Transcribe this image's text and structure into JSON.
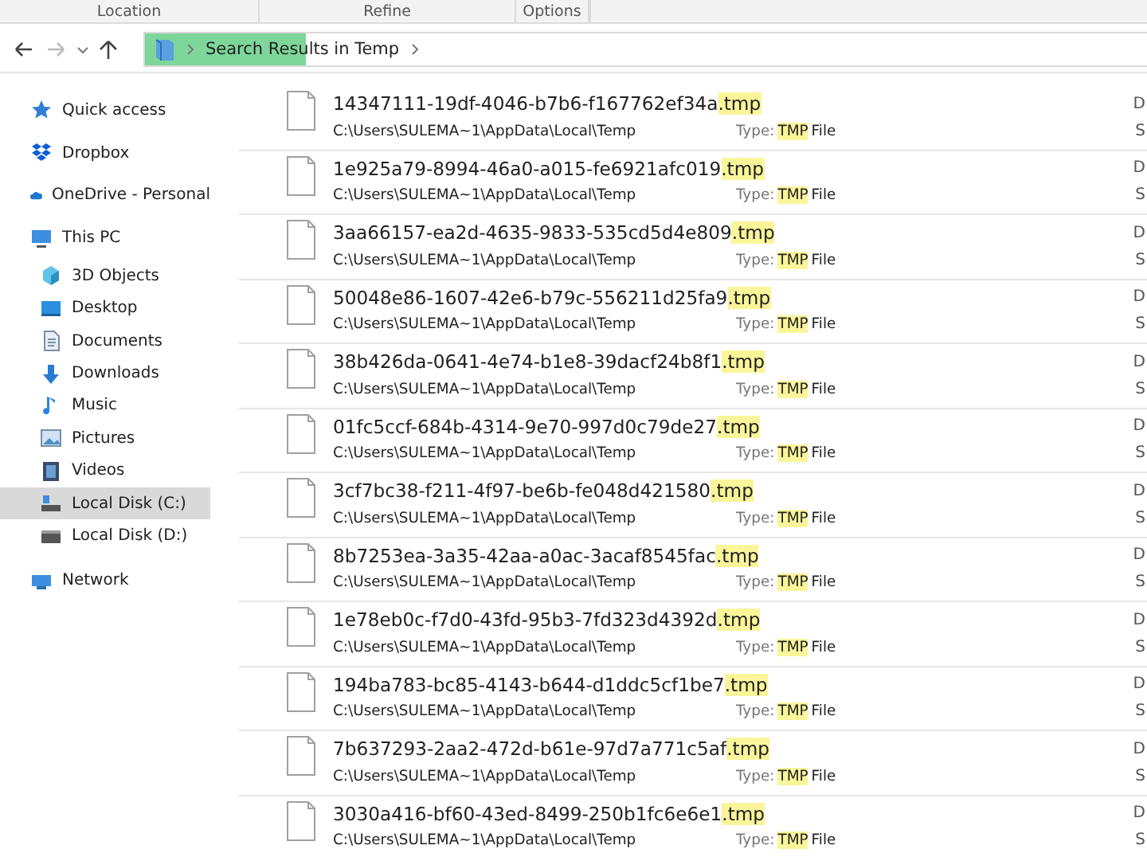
{
  "ribbon": {
    "groups": [
      "Location",
      "Refine",
      "Options"
    ]
  },
  "address_bar": {
    "crumbs": [
      "Search Results in Temp"
    ],
    "level": 0.16
  },
  "sidebar": {
    "items": [
      {
        "label": "Quick access",
        "selected": false
      },
      {
        "label": "Dropbox",
        "selected": false
      },
      {
        "label": "OneDrive - Personal",
        "selected": false
      },
      {
        "label": "This PC",
        "selected": false,
        "children": [
          {
            "label": "3D Objects",
            "selected": false
          },
          {
            "label": "Desktop",
            "selected": false
          },
          {
            "label": "Documents",
            "selected": false
          },
          {
            "label": "Downloads",
            "selected": false
          },
          {
            "label": "Music",
            "selected": false
          },
          {
            "label": "Pictures",
            "selected": false
          },
          {
            "label": "Videos",
            "selected": false
          },
          {
            "label": "Local Disk (C:)",
            "selected": true
          },
          {
            "label": "Local Disk (D:)",
            "selected": false
          }
        ]
      },
      {
        "label": "Network",
        "selected": false
      }
    ]
  },
  "results": [
    {
      "name": "14347111-19df-4046-b7b6-f167762ef34a",
      "extension": ".tmp",
      "path": "C:\\Users\\SULEMA~1\\AppData\\Local\\Temp",
      "type_label": "Type:",
      "type": "TMP",
      "type_suffix": "File",
      "column_3": "D",
      "column_4": "S"
    },
    {
      "name": "1e925a79-8994-46a0-a015-fe6921afc019",
      "extension": ".tmp",
      "path": "C:\\Users\\SULEMA~1\\AppData\\Local\\Temp",
      "type_label": "Type:",
      "type": "TMP",
      "type_suffix": "File",
      "column_3": "D",
      "column_4": "S"
    },
    {
      "name": "3aa66157-ea2d-4635-9833-535cd5d4e809",
      "extension": ".tmp",
      "path": "C:\\Users\\SULEMA~1\\AppData\\Local\\Temp",
      "type_label": "Type:",
      "type": "TMP",
      "type_suffix": "File",
      "column_3": "D",
      "column_4": "S"
    },
    {
      "name": "50048e86-1607-42e6-b79c-556211d25fa9",
      "extension": ".tmp",
      "path": "C:\\Users\\SULEMA~1\\AppData\\Local\\Temp",
      "type_label": "Type:",
      "type": "TMP",
      "type_suffix": "File",
      "column_3": "D",
      "column_4": "S"
    },
    {
      "name": "38b426da-0641-4e74-b1e8-39dacf24b8f1",
      "extension": ".tmp",
      "path": "C:\\Users\\SULEMA~1\\AppData\\Local\\Temp",
      "type_label": "Type:",
      "type": "TMP",
      "type_suffix": "File",
      "column_3": "D",
      "column_4": "S"
    },
    {
      "name": "01fc5ccf-684b-4314-9e70-997d0c79de27",
      "extension": ".tmp",
      "path": "C:\\Users\\SULEMA~1\\AppData\\Local\\Temp",
      "type_label": "Type:",
      "type": "TMP",
      "type_suffix": "File",
      "column_3": "D",
      "column_4": "S"
    },
    {
      "name": "3cf7bc38-f211-4f97-be6b-fe048d421580",
      "extension": ".tmp",
      "path": "C:\\Users\\SULEMA~1\\AppData\\Local\\Temp",
      "type_label": "Type:",
      "type": "TMP",
      "type_suffix": "File",
      "column_3": "D",
      "column_4": "S"
    },
    {
      "name": "8b7253ea-3a35-42aa-a0ac-3acaf8545fac",
      "extension": ".tmp",
      "path": "C:\\Users\\SULEMA~1\\AppData\\Local\\Temp",
      "type_label": "Type:",
      "type": "TMP",
      "type_suffix": "File",
      "column_3": "D",
      "column_4": "S"
    },
    {
      "name": "1e78eb0c-f7d0-43fd-95b3-7fd323d4392d",
      "extension": ".tmp",
      "path": "C:\\Users\\SULEMA~1\\AppData\\Local\\Temp",
      "type_label": "Type:",
      "type": "TMP",
      "type_suffix": "File",
      "column_3": "D",
      "column_4": "S"
    },
    {
      "name": "194ba783-bc85-4143-b644-d1ddc5cf1be7",
      "extension": ".tmp",
      "path": "C:\\Users\\SULEMA~1\\AppData\\Local\\Temp",
      "type_label": "Type:",
      "type": "TMP",
      "type_suffix": "File",
      "column_3": "D",
      "column_4": "S"
    },
    {
      "name": "7b637293-2aa2-472d-b61e-97d7a771c5af",
      "extension": ".tmp",
      "path": "C:\\Users\\SULEMA~1\\AppData\\Local\\Temp",
      "type_label": "Type:",
      "type": "TMP",
      "type_suffix": "File",
      "column_3": "D",
      "column_4": "S"
    },
    {
      "name": "3030a416-bf60-43ed-8499-250b1fc6e6e1",
      "extension": ".tmp",
      "path": "C:\\Users\\SULEMA~1\\AppData\\Local\\Temp",
      "type_label": "Type:",
      "type": "TMP",
      "type_suffix": "File",
      "column_3": "D",
      "column_4": "S"
    }
  ]
}
